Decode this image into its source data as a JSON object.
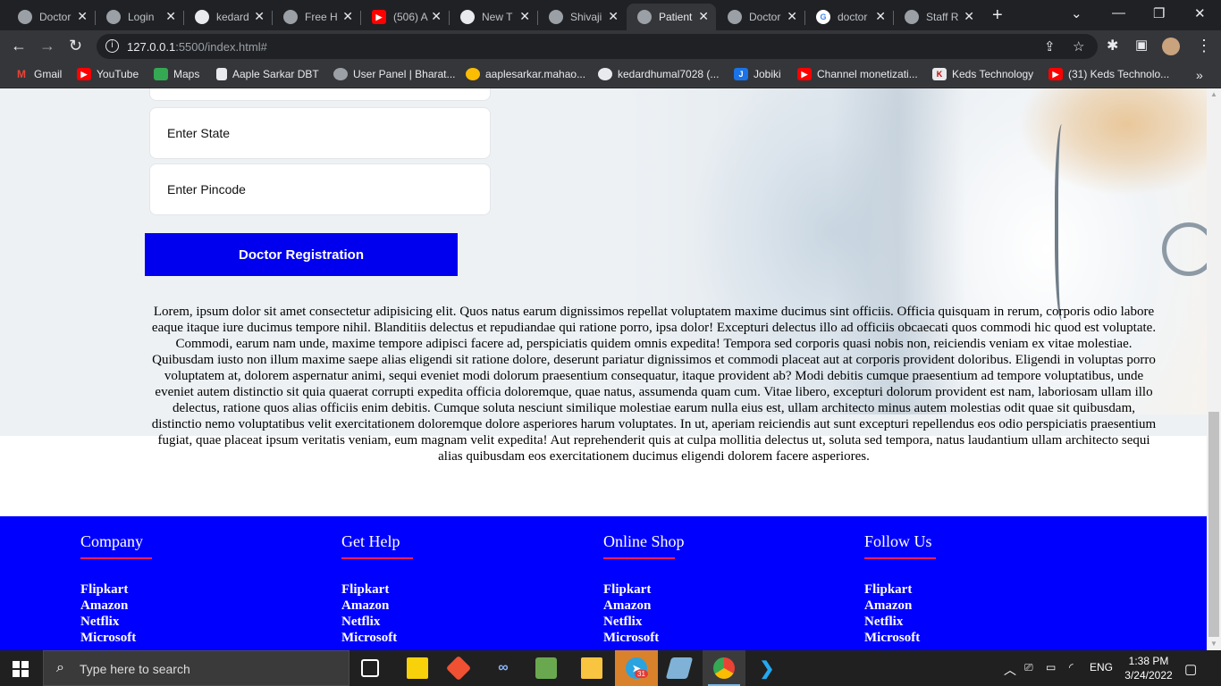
{
  "browser": {
    "tabs": [
      {
        "title": "Doctor",
        "icon": "globe-icon"
      },
      {
        "title": "Login",
        "icon": "globe-icon"
      },
      {
        "title": "kedard",
        "icon": "github-icon"
      },
      {
        "title": "Free H",
        "icon": "globe-icon"
      },
      {
        "title": "(506) A",
        "icon": "youtube-icon"
      },
      {
        "title": "New T",
        "icon": "chrome-icon"
      },
      {
        "title": "Shivaji",
        "icon": "globe-icon"
      },
      {
        "title": "Patient",
        "icon": "globe-icon",
        "active": true
      },
      {
        "title": "Doctor",
        "icon": "globe-icon"
      },
      {
        "title": "doctor",
        "icon": "google-icon"
      },
      {
        "title": "Staff R",
        "icon": "globe-icon"
      }
    ],
    "url_host": "127.0.0.1",
    "url_rest": ":5500/index.html#",
    "bookmarks": [
      {
        "label": "Gmail",
        "icon": "gmail-icon",
        "color": "#ea4335"
      },
      {
        "label": "YouTube",
        "icon": "youtube-icon",
        "color": "#ff0000"
      },
      {
        "label": "Maps",
        "icon": "maps-icon",
        "color": "#34a853"
      },
      {
        "label": "Aaple Sarkar DBT",
        "icon": "page-icon",
        "color": "#8ab4f8"
      },
      {
        "label": "User Panel | Bharat...",
        "icon": "emblem-icon",
        "color": "#9aa0a6"
      },
      {
        "label": "aaplesarkar.mahao...",
        "icon": "sun-icon",
        "color": "#fbbc04"
      },
      {
        "label": "kedardhumal7028 (...",
        "icon": "github-icon",
        "color": "#e8eaed"
      },
      {
        "label": "Jobiki",
        "icon": "jobiki-icon",
        "color": "#1a73e8"
      },
      {
        "label": "Channel monetizati...",
        "icon": "youtube-icon",
        "color": "#ff0000"
      },
      {
        "label": "Keds Technology",
        "icon": "keds-icon",
        "color": "#e8eaed"
      },
      {
        "label": "(31) Keds Technolo...",
        "icon": "youtube-icon",
        "color": "#ff0000"
      }
    ]
  },
  "form": {
    "state_placeholder": "Enter State",
    "pincode_placeholder": "Enter Pincode",
    "submit_label": "Doctor Registration"
  },
  "content": {
    "paragraph": "Lorem, ipsum dolor sit amet consectetur adipisicing elit. Quos natus earum dignissimos repellat voluptatem maxime ducimus sint officiis. Officia quisquam in rerum, corporis odio labore eaque itaque iure ducimus tempore nihil. Blanditiis delectus et repudiandae qui ratione porro, ipsa dolor! Excepturi delectus illo ad officiis obcaecati quos commodi hic quod est voluptate. Commodi, earum nam unde, maxime tempore adipisci facere ad, perspiciatis quidem omnis expedita! Tempora sed corporis quasi nobis non, reiciendis veniam ex vitae molestiae. Quibusdam iusto non illum maxime saepe alias eligendi sit ratione dolore, deserunt pariatur dignissimos et commodi placeat aut at corporis provident doloribus. Eligendi in voluptas porro voluptatem at, dolorem aspernatur animi, sequi eveniet modi dolorum praesentium consequatur, itaque provident ab? Modi debitis cumque praesentium ad tempore voluptatibus, unde eveniet autem distinctio sit quia quaerat corrupti expedita officia doloremque, quae natus, assumenda quam cum. Vitae libero, excepturi dolorum provident est nam, laboriosam ullam illo delectus, ratione quos alias officiis enim debitis. Cumque soluta nesciunt similique molestiae earum nulla eius est, ullam architecto minus autem molestias odit quae sit quibusdam, distinctio nemo voluptatibus velit exercitationem doloremque dolore asperiores harum voluptates. In ut, aperiam reiciendis aut sunt excepturi repellendus eos odio perspiciatis praesentium fugiat, quae placeat ipsum veritatis veniam, eum magnam velit expedita! Aut reprehenderit quis at culpa mollitia delectus ut, soluta sed tempora, natus laudantium ullam architecto sequi alias quibusdam eos exercitationem ducimus eligendi dolorem facere asperiores."
  },
  "footer": {
    "columns": [
      {
        "heading": "Company",
        "links": [
          "Flipkart",
          "Amazon",
          "Netflix",
          "Microsoft"
        ]
      },
      {
        "heading": "Get Help",
        "links": [
          "Flipkart",
          "Amazon",
          "Netflix",
          "Microsoft"
        ]
      },
      {
        "heading": "Online Shop",
        "links": [
          "Flipkart",
          "Amazon",
          "Netflix",
          "Microsoft"
        ]
      },
      {
        "heading": "Follow Us",
        "links": [
          "Flipkart",
          "Amazon",
          "Netflix",
          "Microsoft"
        ]
      }
    ],
    "accent_color": "#ff1e56",
    "background_color": "#0000ff"
  },
  "taskbar": {
    "search_placeholder": "Type here to search",
    "language": "ENG",
    "time": "1:38 PM",
    "date": "3/24/2022",
    "telegram_badge": "31"
  }
}
